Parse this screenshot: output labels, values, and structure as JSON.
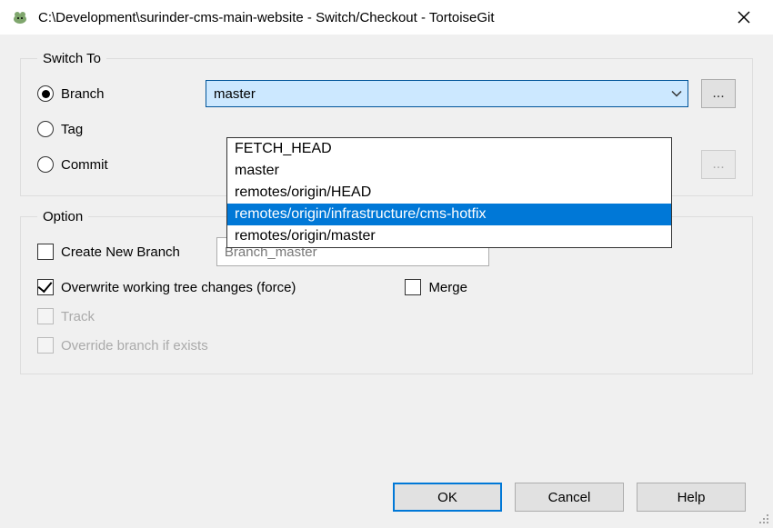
{
  "window": {
    "title": "C:\\Development\\surinder-cms-main-website - Switch/Checkout - TortoiseGit"
  },
  "switch_to": {
    "legend": "Switch To",
    "branch_label": "Branch",
    "tag_label": "Tag",
    "commit_label": "Commit",
    "combo_value": "master",
    "options": [
      "FETCH_HEAD",
      "master",
      "remotes/origin/HEAD",
      "remotes/origin/infrastructure/cms-hotfix",
      "remotes/origin/master"
    ],
    "selected_option_index": 3,
    "browse_label": "..."
  },
  "option": {
    "legend": "Option",
    "create_new_branch": "Create New Branch",
    "branch_name_value": "Branch_master",
    "overwrite": "Overwrite working tree changes (force)",
    "merge": "Merge",
    "track": "Track",
    "override": "Override branch if exists"
  },
  "buttons": {
    "ok": "OK",
    "cancel": "Cancel",
    "help": "Help"
  }
}
